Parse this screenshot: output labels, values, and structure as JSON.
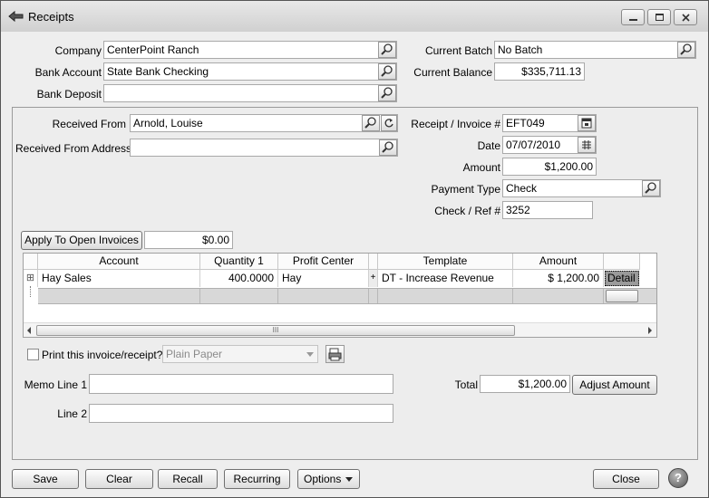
{
  "window": {
    "title": "Receipts"
  },
  "header": {
    "company_label": "Company",
    "company_value": "CenterPoint Ranch",
    "bank_account_label": "Bank Account",
    "bank_account_value": "State Bank Checking",
    "bank_deposit_label": "Bank Deposit",
    "bank_deposit_value": "",
    "current_batch_label": "Current Batch",
    "current_batch_value": "No Batch",
    "current_balance_label": "Current Balance",
    "current_balance_value": "$335,711.13"
  },
  "receipt": {
    "received_from_label": "Received From",
    "received_from_value": "Arnold, Louise",
    "received_from_address_label": "Received From Address",
    "received_from_address_value": "",
    "receipt_invoice_label": "Receipt / Invoice #",
    "receipt_invoice_value": "EFT049",
    "date_label": "Date",
    "date_value": "07/07/2010",
    "amount_label": "Amount",
    "amount_value": "$1,200.00",
    "payment_type_label": "Payment Type",
    "payment_type_value": "Check",
    "check_ref_label": "Check / Ref #",
    "check_ref_value": "3252"
  },
  "apply": {
    "button_label": "Apply To Open Invoices",
    "amount": "$0.00"
  },
  "grid": {
    "columns": [
      "Account",
      "Quantity 1",
      "Profit Center",
      "+",
      "Template",
      "Amount"
    ],
    "rows": [
      {
        "account": "Hay Sales",
        "quantity": "400.0000",
        "profit_center": "Hay",
        "plus": "+",
        "template": "DT - Increase Revenue",
        "amount": "$ 1,200.00",
        "detail": "Detail"
      }
    ],
    "expand_symbol": "⊞",
    "scroll_grip": "III"
  },
  "print": {
    "label": "Print this invoice/receipt?",
    "paper_value": "Plain Paper"
  },
  "memo": {
    "line1_label": "Memo Line 1",
    "line1_value": "",
    "line2_label": "Line 2",
    "line2_value": ""
  },
  "total": {
    "label": "Total",
    "value": "$1,200.00",
    "adjust_label": "Adjust Amount"
  },
  "footer": {
    "save": "Save",
    "clear": "Clear",
    "recall": "Recall",
    "recurring": "Recurring",
    "options": "Options",
    "close": "Close",
    "help": "?"
  }
}
